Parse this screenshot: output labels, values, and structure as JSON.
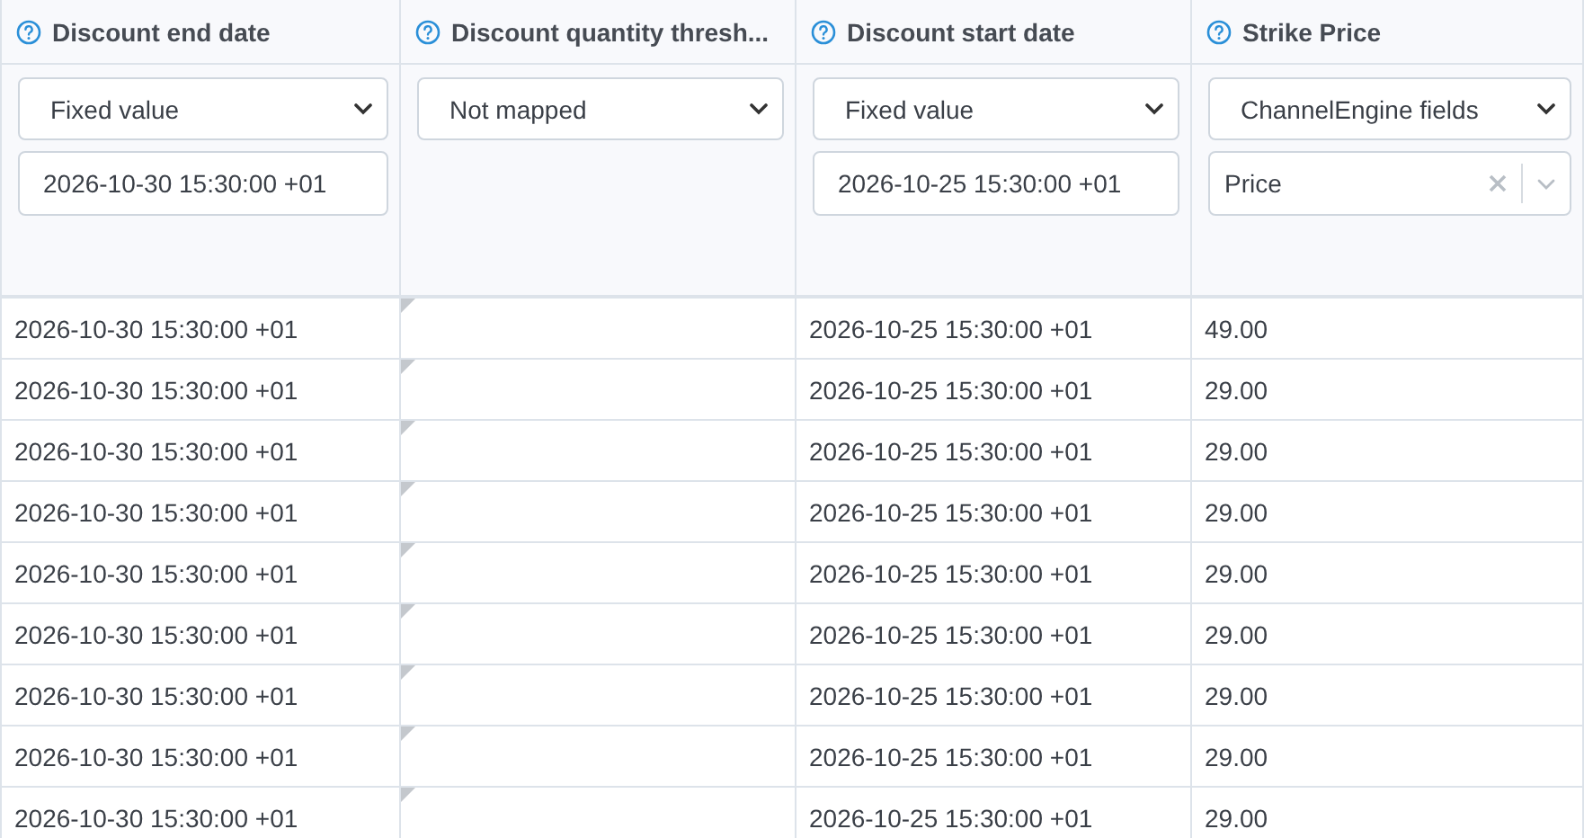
{
  "columns": [
    {
      "title": "Discount end date",
      "mapping": "Fixed value",
      "value": {
        "kind": "input",
        "text": "2026-10-30 15:30:00 +01"
      }
    },
    {
      "title": "Discount quantity thresh...",
      "mapping": "Not mapped"
    },
    {
      "title": "Discount start date",
      "mapping": "Fixed value",
      "value": {
        "kind": "input",
        "text": "2026-10-25 15:30:00 +01"
      }
    },
    {
      "title": "Strike Price",
      "mapping": "ChannelEngine fields",
      "value": {
        "kind": "combo",
        "text": "Price"
      }
    }
  ],
  "rows": [
    {
      "discount_end_date": "2026-10-30 15:30:00 +01",
      "discount_start_date": "2026-10-25 15:30:00 +01",
      "strike_price": "49.00"
    },
    {
      "discount_end_date": "2026-10-30 15:30:00 +01",
      "discount_start_date": "2026-10-25 15:30:00 +01",
      "strike_price": "29.00"
    },
    {
      "discount_end_date": "2026-10-30 15:30:00 +01",
      "discount_start_date": "2026-10-25 15:30:00 +01",
      "strike_price": "29.00"
    },
    {
      "discount_end_date": "2026-10-30 15:30:00 +01",
      "discount_start_date": "2026-10-25 15:30:00 +01",
      "strike_price": "29.00"
    },
    {
      "discount_end_date": "2026-10-30 15:30:00 +01",
      "discount_start_date": "2026-10-25 15:30:00 +01",
      "strike_price": "29.00"
    },
    {
      "discount_end_date": "2026-10-30 15:30:00 +01",
      "discount_start_date": "2026-10-25 15:30:00 +01",
      "strike_price": "29.00"
    },
    {
      "discount_end_date": "2026-10-30 15:30:00 +01",
      "discount_start_date": "2026-10-25 15:30:00 +01",
      "strike_price": "29.00"
    },
    {
      "discount_end_date": "2026-10-30 15:30:00 +01",
      "discount_start_date": "2026-10-25 15:30:00 +01",
      "strike_price": "29.00"
    },
    {
      "discount_end_date": "2026-10-30 15:30:00 +01",
      "discount_start_date": "2026-10-25 15:30:00 +01",
      "strike_price": "29.00"
    }
  ]
}
